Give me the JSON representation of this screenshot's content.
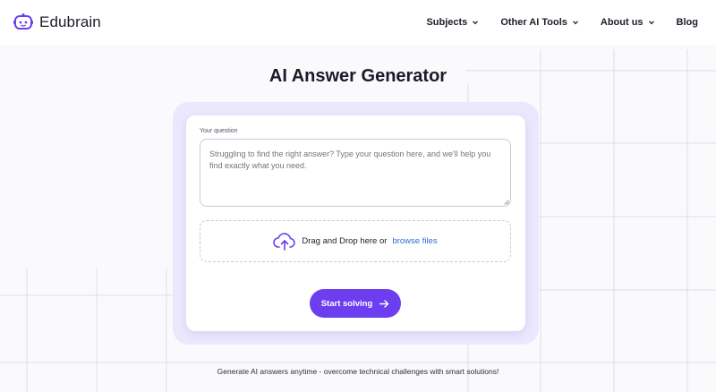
{
  "brand": {
    "name": "Edubrain",
    "accent": "#6c3ef0",
    "logo_icon": "robot-face-icon"
  },
  "nav": {
    "items": [
      {
        "label": "Subjects",
        "has_dropdown": true
      },
      {
        "label": "Other AI Tools",
        "has_dropdown": true
      },
      {
        "label": "About us",
        "has_dropdown": true
      },
      {
        "label": "Blog",
        "has_dropdown": false
      }
    ]
  },
  "main": {
    "title": "AI Answer Generator",
    "question": {
      "label": "Your question",
      "placeholder": "Struggling to find the right answer? Type your question here, and we'll help you find exactly what you need.",
      "value": ""
    },
    "upload": {
      "text": "Drag and Drop here or",
      "link_text": "browse files",
      "icon": "cloud-upload-icon"
    },
    "submit": {
      "label": "Start solving",
      "icon": "arrow-right-icon"
    }
  },
  "footer": {
    "tagline": "Generate AI answers anytime - overcome technical challenges with smart solutions!"
  },
  "colors": {
    "card_outer": "#ebe7fd",
    "link": "#2b6bdc",
    "grid_lines": "#dcdcf2"
  }
}
